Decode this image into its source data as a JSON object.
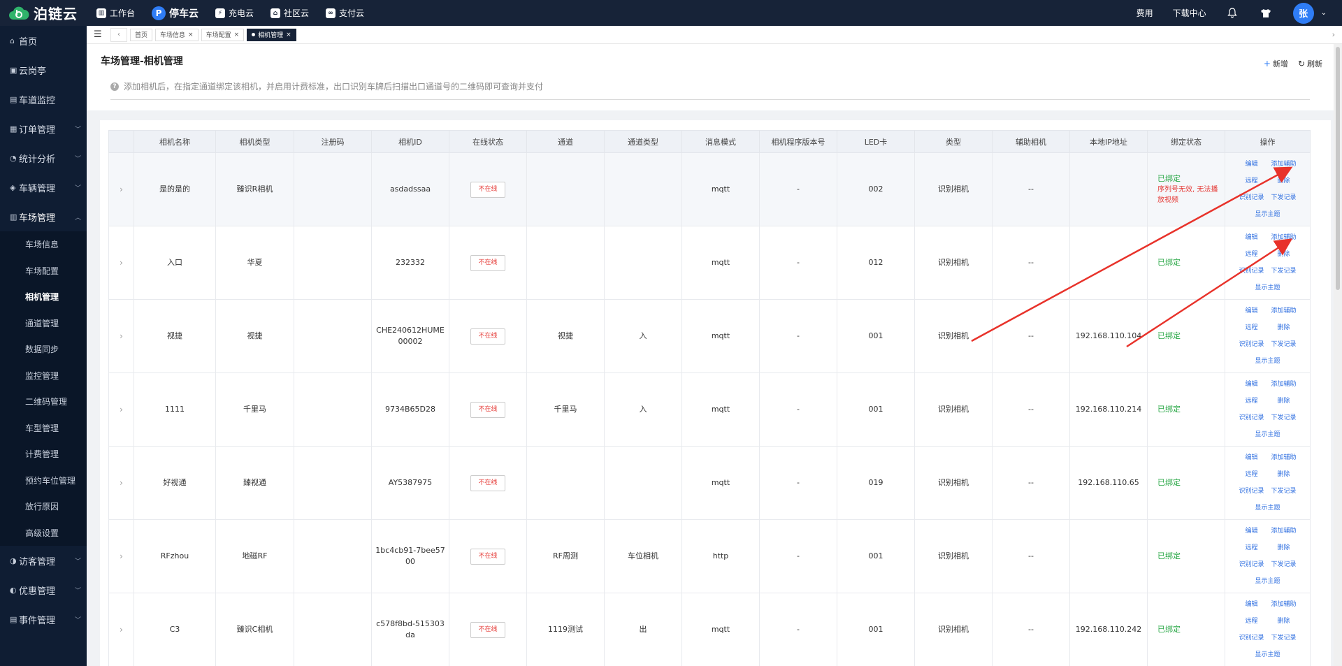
{
  "app": {
    "logo_text": "泊链云",
    "nav": [
      {
        "label": "工作台",
        "icon": "dashboard-icon",
        "glyph": "▥"
      },
      {
        "label": "停车云",
        "icon": "parking-icon",
        "glyph": "P"
      },
      {
        "label": "充电云",
        "icon": "charging-icon",
        "glyph": "⚡"
      },
      {
        "label": "社区云",
        "icon": "community-icon",
        "glyph": "⌂"
      },
      {
        "label": "支付云",
        "icon": "payment-icon",
        "glyph": "∞"
      }
    ],
    "active_nav": "停车云",
    "right": {
      "fee": "费用",
      "download": "下载中心",
      "avatar": "张"
    }
  },
  "sidebar": {
    "groups_top": [
      {
        "label": "首页",
        "icon": "home-icon",
        "glyph": "⌂",
        "caret": false
      },
      {
        "label": "云岗亭",
        "icon": "booth-icon",
        "glyph": "▣",
        "caret": false
      },
      {
        "label": "车道监控",
        "icon": "monitor-icon",
        "glyph": "▤",
        "caret": false
      },
      {
        "label": "订单管理",
        "icon": "order-icon",
        "glyph": "▦",
        "caret": true
      },
      {
        "label": "统计分析",
        "icon": "stats-icon",
        "glyph": "◔",
        "caret": true
      },
      {
        "label": "车辆管理",
        "icon": "vehicle-icon",
        "glyph": "◈",
        "caret": true
      },
      {
        "label": "车场管理",
        "icon": "lot-icon",
        "glyph": "▥",
        "caret": true,
        "open": true
      }
    ],
    "sub_items": [
      "车场信息",
      "车场配置",
      "相机管理",
      "通道管理",
      "数据同步",
      "监控管理",
      "二维码管理",
      "车型管理",
      "计费管理",
      "预约车位管理",
      "放行原因",
      "高级设置"
    ],
    "active_sub": "相机管理",
    "groups_bottom": [
      {
        "label": "访客管理",
        "icon": "visitor-icon",
        "glyph": "◑",
        "caret": true
      },
      {
        "label": "优惠管理",
        "icon": "discount-icon",
        "glyph": "◐",
        "caret": true
      },
      {
        "label": "事件管理",
        "icon": "event-icon",
        "glyph": "▤",
        "caret": true
      }
    ]
  },
  "tabs": [
    {
      "label": "首页",
      "closable": false
    },
    {
      "label": "车场信息",
      "closable": true
    },
    {
      "label": "车场配置",
      "closable": true
    },
    {
      "label": "相机管理",
      "closable": true,
      "active": true
    }
  ],
  "page": {
    "title": "车场管理-相机管理",
    "add_label": "新增",
    "refresh_label": "刷新",
    "tip": "添加相机后，在指定通道绑定该相机，并启用计费标准，出口识别车牌后扫描出口通道号的二维码即可查询并支付"
  },
  "table": {
    "headers": [
      "",
      "相机名称",
      "相机类型",
      "注册码",
      "相机ID",
      "在线状态",
      "通道",
      "通道类型",
      "消息模式",
      "相机程序版本号",
      "LED卡",
      "类型",
      "辅助相机",
      "本地IP地址",
      "绑定状态",
      "操作"
    ],
    "ops": {
      "edit": "编辑",
      "add_aux": "添加辅助",
      "remote": "远程",
      "delete": "删除",
      "recognize_log": "识别记录",
      "issue_log": "下发记录",
      "show_topic": "显示主题"
    },
    "rows": [
      {
        "name": "是的是的",
        "type": "臻识R相机",
        "reg": "",
        "id": "asdadssaa",
        "status": "不在线",
        "channel": "",
        "channel_type": "",
        "mode": "mqtt",
        "version": "-",
        "led": "002",
        "kind": "识别相机",
        "aux": "--",
        "ip": "",
        "bind": "已绑定",
        "bind_error": "序列号无效, 无法播放视频"
      },
      {
        "name": "入口",
        "type": "华夏",
        "reg": "",
        "id": "232332",
        "status": "不在线",
        "channel": "",
        "channel_type": "",
        "mode": "mqtt",
        "version": "-",
        "led": "012",
        "kind": "识别相机",
        "aux": "--",
        "ip": "",
        "bind": "已绑定",
        "bind_error": ""
      },
      {
        "name": "视捷",
        "type": "视捷",
        "reg": "",
        "id": "CHE240612HUME00002",
        "status": "不在线",
        "channel": "视捷",
        "channel_type": "入",
        "mode": "mqtt",
        "version": "-",
        "led": "001",
        "kind": "识别相机",
        "aux": "--",
        "ip": "192.168.110.104",
        "bind": "已绑定",
        "bind_error": ""
      },
      {
        "name": "1111",
        "type": "千里马",
        "reg": "",
        "id": "9734B65D28",
        "status": "不在线",
        "channel": "千里马",
        "channel_type": "入",
        "mode": "mqtt",
        "version": "-",
        "led": "001",
        "kind": "识别相机",
        "aux": "--",
        "ip": "192.168.110.214",
        "bind": "已绑定",
        "bind_error": ""
      },
      {
        "name": "好视通",
        "type": "臻视通",
        "reg": "",
        "id": "AY5387975",
        "status": "不在线",
        "channel": "",
        "channel_type": "",
        "mode": "mqtt",
        "version": "-",
        "led": "019",
        "kind": "识别相机",
        "aux": "--",
        "ip": "192.168.110.65",
        "bind": "已绑定",
        "bind_error": ""
      },
      {
        "name": "RFzhou",
        "type": "地磁RF",
        "reg": "",
        "id": "1bc4cb91-7bee5700",
        "status": "不在线",
        "channel": "RF周测",
        "channel_type": "车位相机",
        "mode": "http",
        "version": "-",
        "led": "001",
        "kind": "识别相机",
        "aux": "--",
        "ip": "",
        "bind": "已绑定",
        "bind_error": ""
      },
      {
        "name": "C3",
        "type": "臻识C相机",
        "reg": "",
        "id": "c578f8bd-515303da",
        "status": "不在线",
        "channel": "1119测试",
        "channel_type": "出",
        "mode": "mqtt",
        "version": "-",
        "led": "001",
        "kind": "识别相机",
        "aux": "--",
        "ip": "192.168.110.242",
        "bind": "已绑定",
        "bind_error": ""
      }
    ]
  },
  "colors": {
    "topbar": "#172338",
    "sidebar": "#0f1d33",
    "accent": "#2f7df6",
    "bound": "#28a745",
    "offline": "#e53935",
    "annotation_arrow": "#e8322a"
  }
}
